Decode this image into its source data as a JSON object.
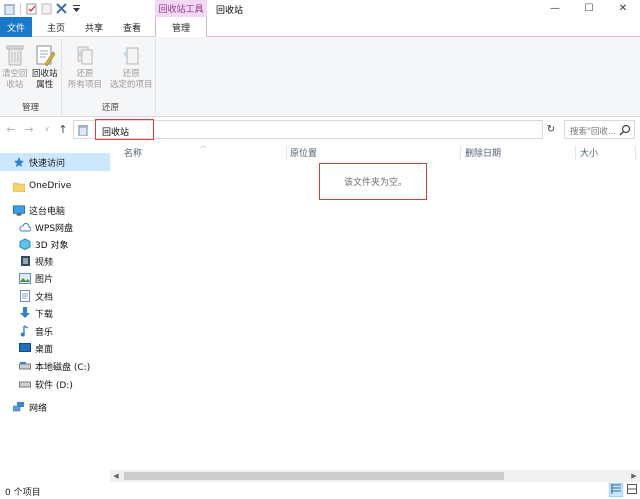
{
  "window": {
    "title": "回收站",
    "context_tab_header": "回收站工具",
    "minimize": "—",
    "maximize": "☐",
    "close": "✕"
  },
  "quick_access_toolbar": {
    "icons": [
      "recycle-bin-icon",
      "properties-check-icon",
      "new-folder-icon",
      "delete-x-icon",
      "customize-dropdown-icon"
    ]
  },
  "ribbon_tabs": {
    "file": "文件",
    "home": "主页",
    "share": "共享",
    "view": "查看",
    "manage": "管理"
  },
  "ribbon": {
    "groups": [
      {
        "name": "管理",
        "buttons": [
          {
            "label_line1": "清空回",
            "label_line2": "收站",
            "icon": "empty-recycle-bin-icon",
            "enabled": false
          },
          {
            "label_line1": "回收站",
            "label_line2": "属性",
            "icon": "recycle-bin-properties-icon",
            "enabled": true
          }
        ]
      },
      {
        "name": "还原",
        "buttons": [
          {
            "label_line1": "还原",
            "label_line2": "所有项目",
            "icon": "restore-all-icon",
            "enabled": false
          },
          {
            "label_line1": "还原",
            "label_line2": "选定的项目",
            "icon": "restore-selected-icon",
            "enabled": false
          }
        ]
      }
    ]
  },
  "address_bar": {
    "back": "←",
    "forward": "→",
    "recent": "∨",
    "up": "↑",
    "path": "回收站",
    "dropdown": "∨",
    "refresh": "↻",
    "search_placeholder": "搜索\"回收..."
  },
  "nav_pane": {
    "items": [
      {
        "label": "快速访问",
        "icon": "star-pin-icon",
        "selected": true
      },
      {
        "label": "OneDrive",
        "icon": "onedrive-folder-icon"
      },
      {
        "label": "这台电脑",
        "icon": "this-pc-icon"
      },
      {
        "label": "WPS网盘",
        "icon": "wps-cloud-icon"
      },
      {
        "label": "3D 对象",
        "icon": "3d-objects-icon"
      },
      {
        "label": "视频",
        "icon": "videos-icon"
      },
      {
        "label": "图片",
        "icon": "pictures-icon"
      },
      {
        "label": "文档",
        "icon": "documents-icon"
      },
      {
        "label": "下载",
        "icon": "download-arrow-icon"
      },
      {
        "label": "音乐",
        "icon": "music-note-icon"
      },
      {
        "label": "桌面",
        "icon": "desktop-icon"
      },
      {
        "label": "本地磁盘 (C:)",
        "icon": "local-disk-icon"
      },
      {
        "label": "软件 (D:)",
        "icon": "drive-icon"
      },
      {
        "label": "网络",
        "icon": "network-icon"
      }
    ]
  },
  "columns": {
    "name": "名称",
    "location": "原位置",
    "deleted_date": "删除日期",
    "size": "大小"
  },
  "content": {
    "empty_message": "该文件夹为空。"
  },
  "status_bar": {
    "item_count": "0 个项目"
  },
  "colors": {
    "file_tab": "#1979ca",
    "context_tab": "#f3d7f3",
    "selection": "#cce8ff",
    "highlight_box": "#e13a3a"
  }
}
